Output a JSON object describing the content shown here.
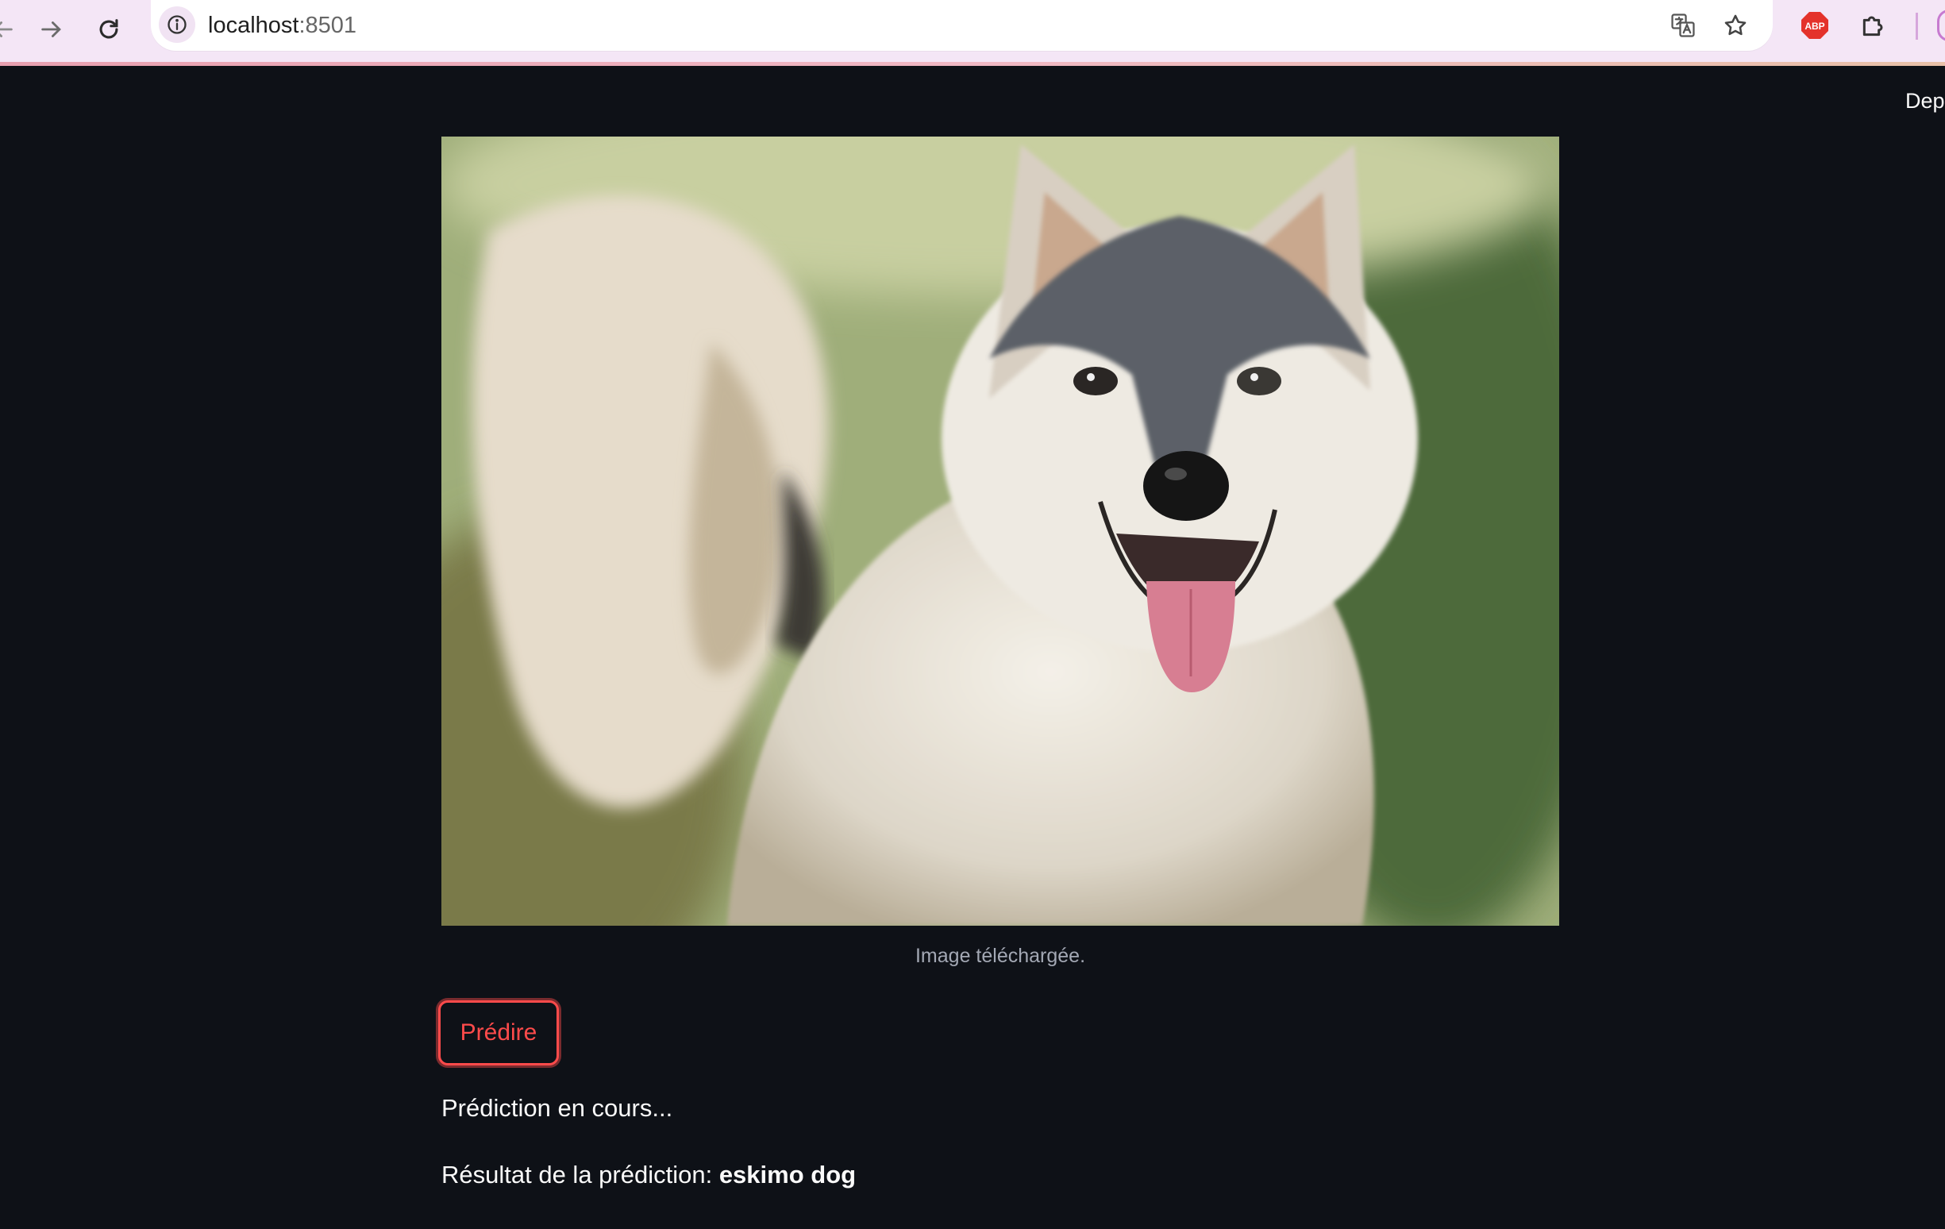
{
  "browser": {
    "url_host": "localhost",
    "url_port": ":8501",
    "icons": {
      "back": "arrow-left-icon",
      "forward": "arrow-right-icon",
      "reload": "reload-icon",
      "site_info": "info-icon",
      "translate": "translate-icon",
      "bookmark": "star-icon",
      "adblock": "abp-icon",
      "extensions": "puzzle-icon"
    },
    "adblock_label": "ABP",
    "colors": {
      "toolbar": "#f4e6f6",
      "accent": "#ff4b4b"
    }
  },
  "app": {
    "deploy_label": "Dep",
    "image_caption": "Image téléchargée.",
    "predict_button": "Prédire",
    "status": "Prédiction en cours...",
    "result_prefix": "Résultat de la prédiction: ",
    "result_value": "eskimo dog",
    "colors": {
      "background": "#0e1117",
      "text": "#fafafa",
      "caption": "#a3a8b4"
    }
  }
}
